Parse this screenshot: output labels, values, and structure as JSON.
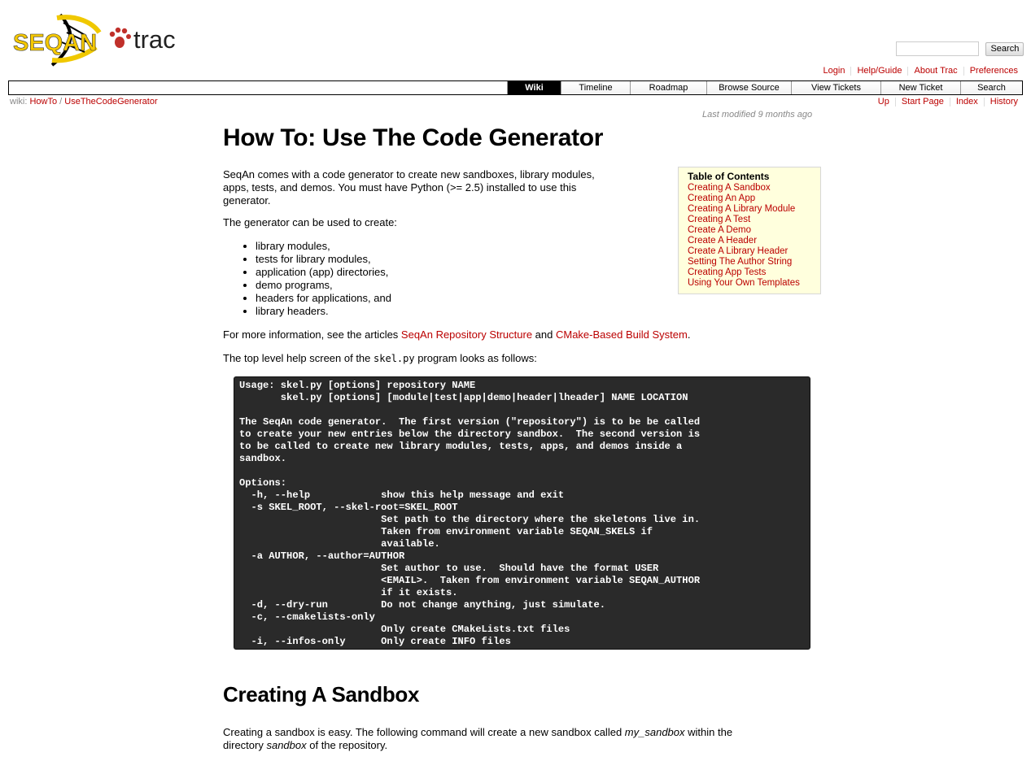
{
  "header": {
    "logo_alt": "SEQAN trac",
    "search_placeholder": "",
    "search_button": "Search"
  },
  "metanav": [
    "Login",
    "Help/Guide",
    "About Trac",
    "Preferences"
  ],
  "mainnav": [
    {
      "label": "Wiki",
      "active": true
    },
    {
      "label": "Timeline",
      "active": false
    },
    {
      "label": "Roadmap",
      "active": false
    },
    {
      "label": "Browse Source",
      "active": false
    },
    {
      "label": "View Tickets",
      "active": false
    },
    {
      "label": "New Ticket",
      "active": false
    },
    {
      "label": "Search",
      "active": false
    }
  ],
  "breadcrumb": {
    "prefix": "wiki:",
    "parts": [
      "HowTo",
      "UseTheCodeGenerator"
    ],
    "sep": "/"
  },
  "ctxtnav": [
    "Up",
    "Start Page",
    "Index",
    "History"
  ],
  "lastmod": {
    "prefix": "Last modified",
    "age": "9 months ago"
  },
  "page": {
    "title": "How To: Use The Code Generator",
    "intro_lines": [
      "SeqAn comes with a code generator to create new sandboxes, library modules,",
      "apps, tests, and demos. You must have Python (>= 2.5) installed to use this",
      "generator."
    ],
    "can_create": "The generator can be used to create:",
    "list": [
      "library modules,",
      "tests for library modules,",
      "application (app) directories,",
      "demo programs,",
      "headers for applications, and",
      "library headers."
    ],
    "more_info": {
      "before": "For more information, see the articles ",
      "link1": "SeqAn Repository Structure",
      "mid": " and ",
      "link2": "CMake-Based Build System",
      "after": "."
    },
    "help_screen": {
      "before": "The top level help screen of the ",
      "code": "skel.py",
      "after": " program looks as follows:"
    },
    "code_block": "Usage: skel.py [options] repository NAME\n       skel.py [options] [module|test|app|demo|header|lheader] NAME LOCATION\n\nThe SeqAn code generator.  The first version (\"repository\") is to be be called\nto create your new entries below the directory sandbox.  The second version is\nto be called to create new library modules, tests, apps, and demos inside a\nsandbox.\n\nOptions:\n  -h, --help            show this help message and exit\n  -s SKEL_ROOT, --skel-root=SKEL_ROOT\n                        Set path to the directory where the skeletons live in.\n                        Taken from environment variable SEQAN_SKELS if\n                        available.\n  -a AUTHOR, --author=AUTHOR\n                        Set author to use.  Should have the format USER\n                        <EMAIL>.  Taken from environment variable SEQAN_AUTHOR\n                        if it exists.\n  -d, --dry-run         Do not change anything, just simulate.\n  -c, --cmakelists-only\n                        Only create CMakeLists.txt files\n  -i, --infos-only      Only create INFO files",
    "section_title": "Creating A Sandbox",
    "sandbox_text": {
      "a": "Creating a sandbox is easy. The following command will create a new sandbox called ",
      "em1": "my_sandbox",
      "b": " within the",
      "c": "directory ",
      "em2": "sandbox",
      "d": " of the repository."
    }
  },
  "toc": {
    "title": "Table of Contents",
    "items": [
      "Creating A Sandbox",
      "Creating An App",
      "Creating A Library Module",
      "Creating A Test",
      "Create A Demo",
      "Create A Header",
      "Create A Library Header",
      "Setting The Author String",
      "Creating App Tests",
      "Using Your Own Templates"
    ]
  }
}
